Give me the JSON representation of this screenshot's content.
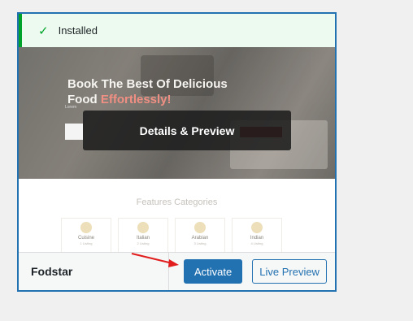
{
  "notice": {
    "icon": "check-icon",
    "text": "Installed"
  },
  "screenshot": {
    "hero_title_line1": "Book The Best Of Delicious",
    "hero_title_line2_plain": "Food ",
    "hero_title_line2_accent": "Effortlessly!",
    "hero_small": "Lorem",
    "overlay_label": "Details & Preview",
    "features_title": "Features Categories",
    "categories": [
      {
        "name": "Cuisine",
        "count": "1 Listing"
      },
      {
        "name": "Italian",
        "count": "2 Listing"
      },
      {
        "name": "Arabian",
        "count": "3 Listing"
      },
      {
        "name": "Indian",
        "count": "4 Listing"
      }
    ]
  },
  "footer": {
    "theme_name": "Fodstar",
    "activate_label": "Activate",
    "live_preview_label": "Live Preview"
  },
  "colors": {
    "accent": "#2271b1",
    "success": "#00a32a",
    "arrow": "#e11d1d"
  }
}
